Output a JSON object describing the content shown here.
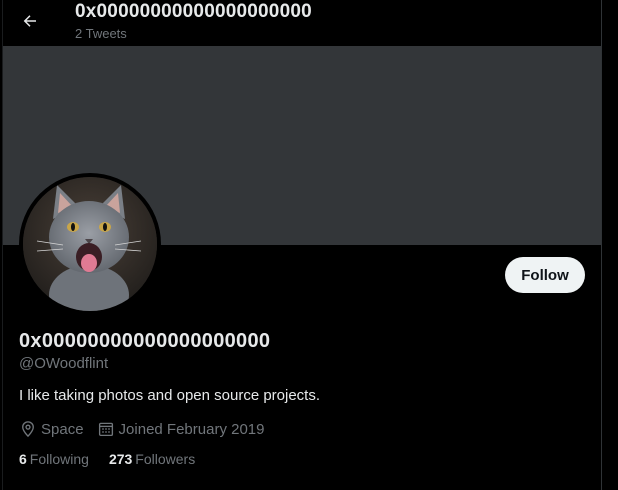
{
  "header": {
    "title": "0x00000000000000000000",
    "subtitle": "2 Tweets",
    "back_icon": "arrow-left-icon"
  },
  "profile": {
    "display_name": "0x00000000000000000000",
    "handle": "@OWoodflint",
    "bio": "I like taking photos and open source projects.",
    "location": "Space",
    "location_icon": "location-pin-icon",
    "joined": "Joined February 2019",
    "joined_icon": "calendar-icon",
    "follow_label": "Follow",
    "avatar_description": "grey kitten"
  },
  "stats": {
    "following_count": "6",
    "following_label": "Following",
    "followers_count": "273",
    "followers_label": "Followers"
  },
  "colors": {
    "background": "#000000",
    "banner": "#333639",
    "text_primary": "#e7e9ea",
    "text_secondary": "#71767b",
    "follow_button_bg": "#eff3f4"
  }
}
